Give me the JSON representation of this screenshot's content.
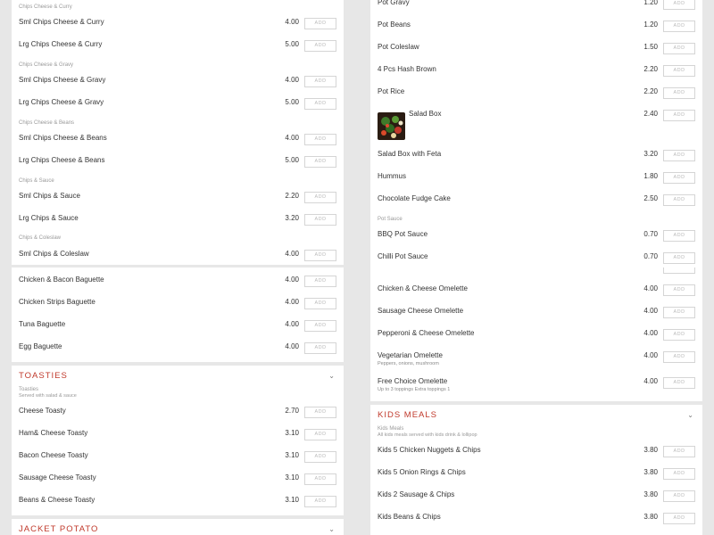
{
  "add_label": "ADD",
  "left": {
    "groups1": [
      {
        "label": "Chips Cheese & Curry",
        "items": [
          {
            "name": "Sml Chips Cheese & Curry",
            "price": "4.00"
          },
          {
            "name": "Lrg Chips Cheese & Curry",
            "price": "5.00"
          }
        ]
      },
      {
        "label": "Chips Cheese & Gravy",
        "items": [
          {
            "name": "Sml Chips Cheese & Gravy",
            "price": "4.00"
          },
          {
            "name": "Lrg Chips Cheese & Gravy",
            "price": "5.00"
          }
        ]
      },
      {
        "label": "Chips Cheese & Beans",
        "items": [
          {
            "name": "Sml Chips Cheese & Beans",
            "price": "4.00"
          },
          {
            "name": "Lrg Chips Cheese & Beans",
            "price": "5.00"
          }
        ]
      },
      {
        "label": "Chips & Sauce",
        "items": [
          {
            "name": "Sml Chips & Sauce",
            "price": "2.20"
          },
          {
            "name": "Lrg Chips & Sauce",
            "price": "3.20"
          }
        ]
      },
      {
        "label": "Chips & Coleslaw",
        "items": [
          {
            "name": "Sml Chips & Coleslaw",
            "price": "4.00"
          }
        ]
      }
    ],
    "baguettes": [
      {
        "name": "Chicken & Bacon Baguette",
        "price": "4.00"
      },
      {
        "name": "Chicken Strips Baguette",
        "price": "4.00"
      },
      {
        "name": "Tuna Baguette",
        "price": "4.00"
      },
      {
        "name": "Egg Baguette",
        "price": "4.00"
      }
    ],
    "toasties": {
      "header": "TOASTIES",
      "label": "Toasties",
      "note": "Served with salad & sauce",
      "items": [
        {
          "name": "Cheese Toasty",
          "price": "2.70"
        },
        {
          "name": "Ham& Cheese Toasty",
          "price": "3.10"
        },
        {
          "name": "Bacon Cheese Toasty",
          "price": "3.10"
        },
        {
          "name": "Sausage Cheese Toasty",
          "price": "3.10"
        },
        {
          "name": "Beans & Cheese Toasty",
          "price": "3.10"
        }
      ]
    },
    "jacket": {
      "header": "JACKET POTATO"
    }
  },
  "right": {
    "pots": [
      {
        "name": "Pot Gravy",
        "price": "1.20"
      },
      {
        "name": "Pot Beans",
        "price": "1.20"
      },
      {
        "name": "Pot Coleslaw",
        "price": "1.50"
      },
      {
        "name": "4 Pcs Hash Brown",
        "price": "2.20"
      },
      {
        "name": "Pot Rice",
        "price": "2.20"
      },
      {
        "name": "Salad Box",
        "price": "2.40",
        "image": true
      },
      {
        "name": "Salad Box with Feta",
        "price": "3.20"
      },
      {
        "name": "Hummus",
        "price": "1.80"
      },
      {
        "name": "Chocolate Fudge Cake",
        "price": "2.50"
      }
    ],
    "pot_sauce": {
      "label": "Pot Sauce",
      "items": [
        {
          "name": "BBQ Pot Sauce",
          "price": "0.70"
        },
        {
          "name": "Chilli Pot Sauce",
          "price": "0.70"
        }
      ]
    },
    "omelettes": [
      {
        "name": "Chicken & Cheese Omelette",
        "price": "4.00"
      },
      {
        "name": "Sausage Cheese Omelette",
        "price": "4.00"
      },
      {
        "name": "Pepperoni & Cheese Omelette",
        "price": "4.00"
      },
      {
        "name": "Vegetarian Omelette",
        "price": "4.00",
        "sub": "Peppers, onions, mushroom"
      },
      {
        "name": "Free Choice Omelette",
        "price": "4.00",
        "sub": "Up to 3 toppings Extra toppings 1"
      }
    ],
    "kids": {
      "header": "KIDS MEALS",
      "label": "Kids Meals",
      "note": "All kids meals served with kids drink & lollipop",
      "items": [
        {
          "name": "Kids 5 Chicken Nuggets & Chips",
          "price": "3.80"
        },
        {
          "name": "Kids 5 Onion Rings & Chips",
          "price": "3.80"
        },
        {
          "name": "Kids 2 Sausage & Chips",
          "price": "3.80"
        },
        {
          "name": "Kids Beans & Chips",
          "price": "3.80"
        }
      ]
    }
  },
  "colors": {
    "accent": "#c0392b",
    "page": "#e7e7e7",
    "panel": "#ffffff"
  }
}
